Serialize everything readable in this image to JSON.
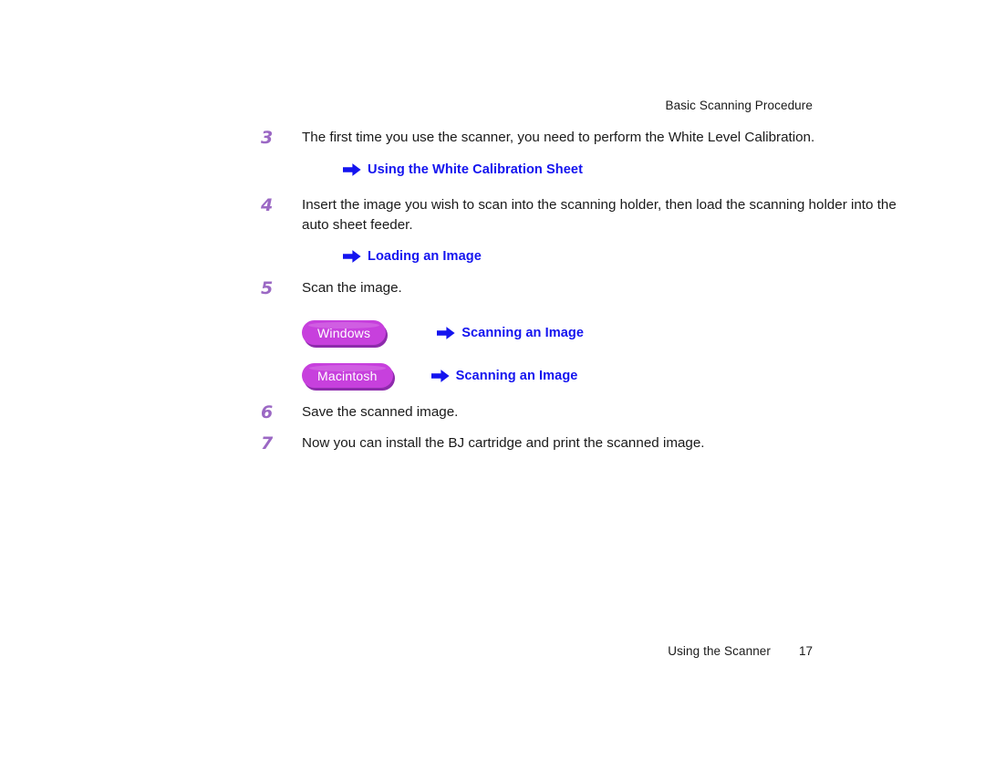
{
  "header": {
    "running_title": "Basic Scanning Procedure"
  },
  "colors": {
    "step_number": "#9b68c4",
    "link_blue": "#1414ef",
    "pill_fill": "#c740dd",
    "pill_shadow": "#8e2bac",
    "body_text": "#1a1a1a",
    "page_background": "#ffffff"
  },
  "steps": [
    {
      "number": "3",
      "text": "The first time you use the scanner, you need to perform the White Level Calibration."
    },
    {
      "number": "4",
      "text": "Insert the image you wish to scan into the scanning holder, then load the scanning holder into the auto sheet feeder."
    },
    {
      "number": "5",
      "text": "Scan the image."
    },
    {
      "number": "6",
      "text": "Save the scanned image."
    },
    {
      "number": "7",
      "text": "Now you can install the BJ cartridge and print the scanned image."
    }
  ],
  "links": {
    "white_calibration": {
      "label": "Using the White Calibration Sheet",
      "icon": "arrow-right-icon"
    },
    "loading_image": {
      "label": "Loading an Image",
      "icon": "arrow-right-icon"
    },
    "scanning_windows": {
      "label": "Scanning an Image",
      "icon": "arrow-right-icon"
    },
    "scanning_macintosh": {
      "label": "Scanning an Image",
      "icon": "arrow-right-icon"
    }
  },
  "platforms": [
    {
      "label": "Windows"
    },
    {
      "label": "Macintosh"
    }
  ],
  "footer": {
    "section": "Using the Scanner",
    "page_number": "17"
  }
}
